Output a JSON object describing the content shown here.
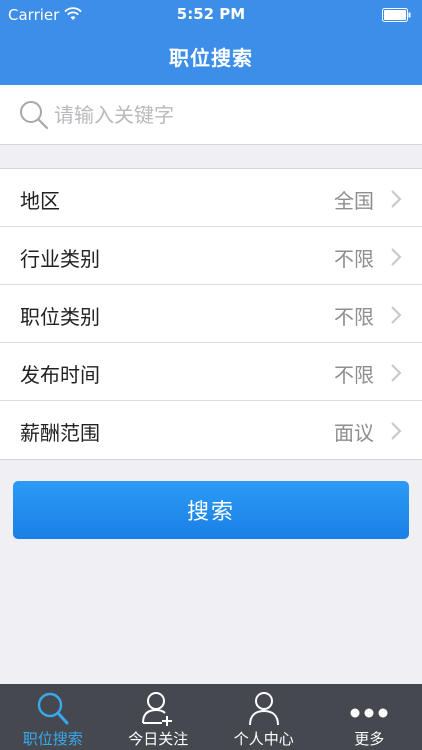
{
  "status_bar": {
    "carrier": "Carrier",
    "time": "5:52 PM"
  },
  "header": {
    "title": "职位搜索"
  },
  "search": {
    "placeholder": "请输入关键字",
    "value": ""
  },
  "filters": [
    {
      "label": "地区",
      "value": "全国"
    },
    {
      "label": "行业类别",
      "value": "不限"
    },
    {
      "label": "职位类别",
      "value": "不限"
    },
    {
      "label": "发布时间",
      "value": "不限"
    },
    {
      "label": "薪酬范围",
      "value": "面议"
    }
  ],
  "search_button": {
    "label": "搜索"
  },
  "tabs": [
    {
      "label": "职位搜索",
      "icon": "search-icon",
      "active": true
    },
    {
      "label": "今日关注",
      "icon": "user-add-icon",
      "active": false
    },
    {
      "label": "个人中心",
      "icon": "user-icon",
      "active": false
    },
    {
      "label": "更多",
      "icon": "more-icon",
      "active": false
    }
  ],
  "colors": {
    "header_bg": "#3c8ee8",
    "button_bg": "#1a7fe6",
    "tab_bar_bg": "#45494f",
    "tab_active": "#39a9ee"
  }
}
